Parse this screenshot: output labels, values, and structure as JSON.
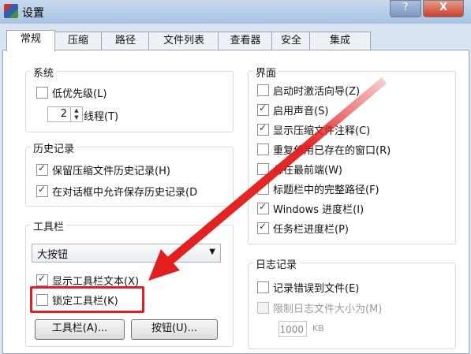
{
  "window": {
    "title": "设置"
  },
  "titlebar": {
    "help_label": "?",
    "close_label": "X"
  },
  "tabs": [
    "常规",
    "压缩",
    "路径",
    "文件列表",
    "查看器",
    "安全",
    "集成"
  ],
  "system": {
    "title": "系统",
    "low_priority": {
      "label": "低优先级(L)",
      "checked": false
    },
    "threads": {
      "value": "2",
      "label": "线程(T)"
    }
  },
  "history": {
    "title": "历史记录",
    "items": [
      {
        "label": "保留压缩文件历史记录(H)",
        "checked": true
      },
      {
        "label": "在对话框中允许保存历史记录(D",
        "checked": true
      }
    ]
  },
  "toolbar": {
    "title": "工具栏",
    "style_select": "大按钮",
    "show_text": {
      "label": "显示工具栏文本(X)",
      "checked": true
    },
    "lock": {
      "label": "锁定工具栏(K)",
      "checked": false
    },
    "toolbar_button": "工具栏(A)...",
    "buttons_button": "按钮(U)..."
  },
  "interface": {
    "title": "界面",
    "items": [
      {
        "label": "启动时激活向导(Z)",
        "checked": false
      },
      {
        "label": "启用声音(S)",
        "checked": true
      },
      {
        "label": "显示压缩文件注释(C)",
        "checked": true
      },
      {
        "label": "重复使用已存在的窗口(R)",
        "checked": false
      },
      {
        "label": "总在最前端(W)",
        "checked": false
      },
      {
        "label": "标题栏中的完整路径(F)",
        "checked": false
      },
      {
        "label": "Windows 进度栏(I)",
        "checked": true
      },
      {
        "label": "任务栏进度栏(P)",
        "checked": true
      }
    ]
  },
  "log": {
    "title": "日志记录",
    "log_errors": {
      "label": "记录错误到文件(E)",
      "checked": false
    },
    "limit_size": {
      "label": "限制日志文件大小为(M)",
      "checked": false,
      "disabled": true
    },
    "size_value": "1000",
    "size_unit": "KB"
  },
  "colors": {
    "highlight": "#e21f1f",
    "accent": "#1e395b"
  }
}
